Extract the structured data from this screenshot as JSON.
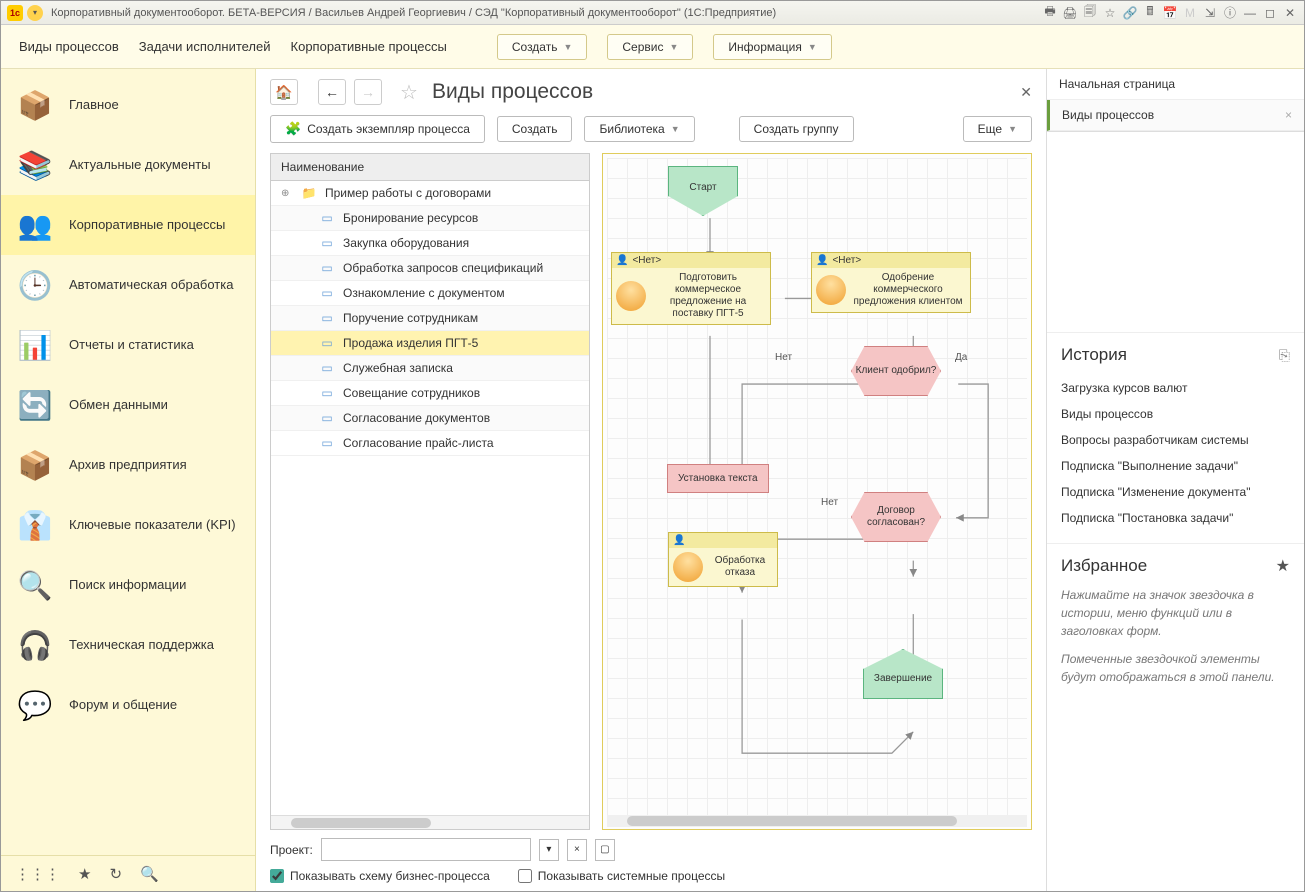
{
  "window": {
    "title": "Корпоративный документооборот. БЕТА-ВЕРСИЯ / Васильев Андрей Георгиевич / СЭД \"Корпоративный документооборот\"  (1С:Предприятие)"
  },
  "menubar": {
    "links": [
      "Виды процессов",
      "Задачи исполнителей",
      "Корпоративные процессы"
    ],
    "buttons": {
      "create": "Создать",
      "service": "Сервис",
      "info": "Информация"
    }
  },
  "sidebar": {
    "items": [
      {
        "label": "Главное",
        "icon": "📦"
      },
      {
        "label": "Актуальные документы",
        "icon": "📚"
      },
      {
        "label": "Корпоративные процессы",
        "icon": "👥",
        "active": true
      },
      {
        "label": "Автоматическая обработка",
        "icon": "🕒"
      },
      {
        "label": "Отчеты и статистика",
        "icon": "📊"
      },
      {
        "label": "Обмен данными",
        "icon": "🔄"
      },
      {
        "label": "Архив предприятия",
        "icon": "📦"
      },
      {
        "label": "Ключевые показатели (KPI)",
        "icon": "👔"
      },
      {
        "label": "Поиск информации",
        "icon": "🔍"
      },
      {
        "label": "Техническая поддержка",
        "icon": "🎧"
      },
      {
        "label": "Форум и общение",
        "icon": "💬"
      }
    ]
  },
  "page": {
    "title": "Виды процессов",
    "toolbar": {
      "create_instance": "Создать экземпляр процесса",
      "create": "Создать",
      "library": "Библиотека",
      "create_group": "Создать группу",
      "more": "Еще"
    },
    "tree": {
      "header": "Наименование",
      "rows": [
        {
          "label": "Пример работы с договорами",
          "folder": true,
          "expand": true
        },
        {
          "label": "Бронирование ресурсов"
        },
        {
          "label": "Закупка оборудования"
        },
        {
          "label": "Обработка запросов спецификаций"
        },
        {
          "label": "Ознакомление с документом"
        },
        {
          "label": "Поручение сотрудникам"
        },
        {
          "label": "Продажа изделия ПГТ-5",
          "selected": true
        },
        {
          "label": "Служебная записка"
        },
        {
          "label": "Совещание сотрудников"
        },
        {
          "label": "Согласование документов"
        },
        {
          "label": "Согласование прайс-листа"
        }
      ]
    },
    "project_label": "Проект:",
    "show_scheme": "Показывать схему бизнес-процесса",
    "show_system": "Показывать системные процессы"
  },
  "diagram": {
    "start": "Старт",
    "end": "Завершение",
    "task1_owner": "<Нет>",
    "task1_text": "Подготовить коммерческое предложение на поставку ПГТ-5",
    "task2_owner": "<Нет>",
    "task2_text": "Одобрение коммерческого предложения клиентом",
    "decision1": "Клиент одобрил?",
    "action1": "Установка текста",
    "decision2": "Договор согласован?",
    "task3_text": "Обработка отказа",
    "label_no": "Нет",
    "label_yes": "Да"
  },
  "rightpane": {
    "tab_home": "Начальная страница",
    "tab_current": "Виды процессов",
    "history_title": "История",
    "history": [
      "Загрузка курсов валют",
      "Виды процессов",
      "Вопросы разработчикам системы",
      "Подписка \"Выполнение задачи\"",
      "Подписка \"Изменение документа\"",
      "Подписка \"Постановка задачи\""
    ],
    "fav_title": "Избранное",
    "fav_hint1": "Нажимайте на значок звездочка в истории, меню функций или в заголовках форм.",
    "fav_hint2": "Помеченные звездочкой элементы будут отображаться в этой панели."
  }
}
